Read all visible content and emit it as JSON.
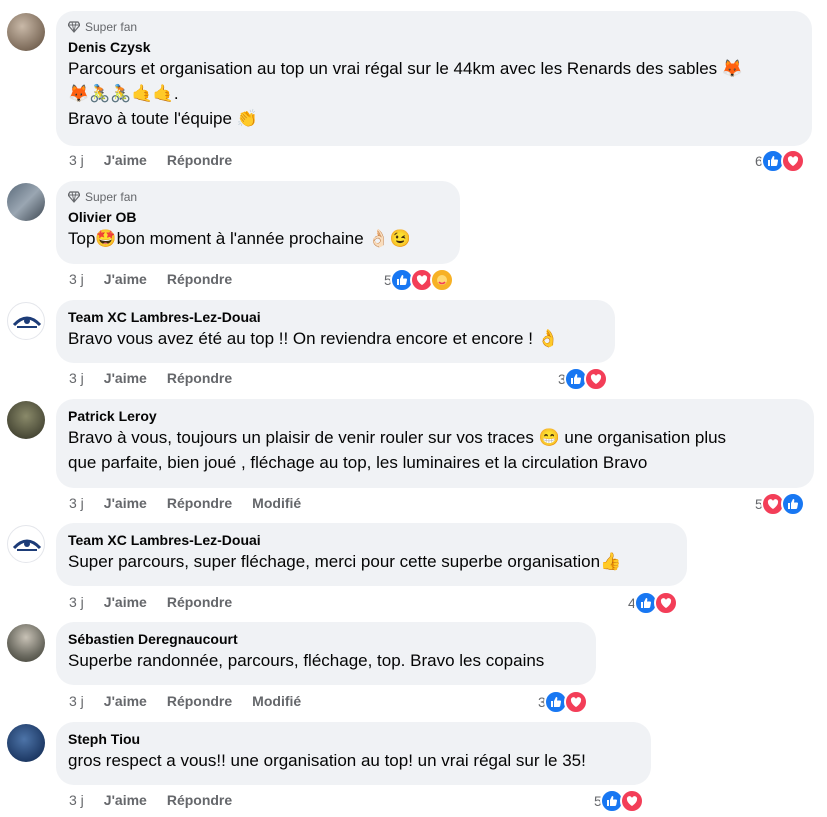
{
  "comments": [
    {
      "badge": "Super fan",
      "author": "Denis Czysk",
      "lines": [
        "Parcours et organisation au top un vrai régal sur le 44km avec les Renards des sables 🦊",
        "🦊🚴🚴🤙🤙.",
        "Bravo à toute l'équipe 👏"
      ],
      "time": "3 j",
      "like": "J'aime",
      "reply": "Répondre",
      "edited": "",
      "reaction_count": "6",
      "reactions": [
        "like",
        "love"
      ]
    },
    {
      "badge": "Super fan",
      "author": "Olivier OB",
      "lines": [
        "Top🤩bon moment à l'année prochaine 👌🏻😉"
      ],
      "time": "3 j",
      "like": "J'aime",
      "reply": "Répondre",
      "edited": "",
      "reaction_count": "5",
      "reactions": [
        "like",
        "love",
        "care"
      ]
    },
    {
      "badge": "",
      "author": "Team XC Lambres-Lez-Douai",
      "lines": [
        "Bravo vous avez été au top !! On reviendra encore et encore ! 👌"
      ],
      "time": "3 j",
      "like": "J'aime",
      "reply": "Répondre",
      "edited": "",
      "reaction_count": "3",
      "reactions": [
        "like",
        "love"
      ]
    },
    {
      "badge": "",
      "author": "Patrick Leroy",
      "lines": [
        "Bravo à vous, toujours un plaisir de venir rouler sur vos traces 😁 une organisation plus",
        "que parfaite, bien joué , fléchage au top, les luminaires et la circulation Bravo"
      ],
      "time": "3 j",
      "like": "J'aime",
      "reply": "Répondre",
      "edited": "Modifié",
      "reaction_count": "5",
      "reactions": [
        "love",
        "like"
      ]
    },
    {
      "badge": "",
      "author": "Team XC Lambres-Lez-Douai",
      "lines": [
        "Super parcours, super fléchage, merci pour cette superbe organisation👍"
      ],
      "time": "3 j",
      "like": "J'aime",
      "reply": "Répondre",
      "edited": "",
      "reaction_count": "4",
      "reactions": [
        "like",
        "love"
      ]
    },
    {
      "badge": "",
      "author": "Sébastien Deregnaucourt",
      "lines": [
        "Superbe randonnée, parcours, fléchage, top. Bravo les copains"
      ],
      "time": "3 j",
      "like": "J'aime",
      "reply": "Répondre",
      "edited": "Modifié",
      "reaction_count": "3",
      "reactions": [
        "like",
        "love"
      ]
    },
    {
      "badge": "",
      "author": "Steph Tiou",
      "lines": [
        "gros respect a vous!! une organisation au top! un vrai régal sur le 35!"
      ],
      "time": "3 j",
      "like": "J'aime",
      "reply": "Répondre",
      "edited": "",
      "reaction_count": "5",
      "reactions": [
        "like",
        "love"
      ]
    }
  ],
  "colors": {
    "like": "#1877f2",
    "love": "#f33e58",
    "care": "#f7b125",
    "bubble": "#f0f2f5",
    "meta": "#65676b"
  }
}
